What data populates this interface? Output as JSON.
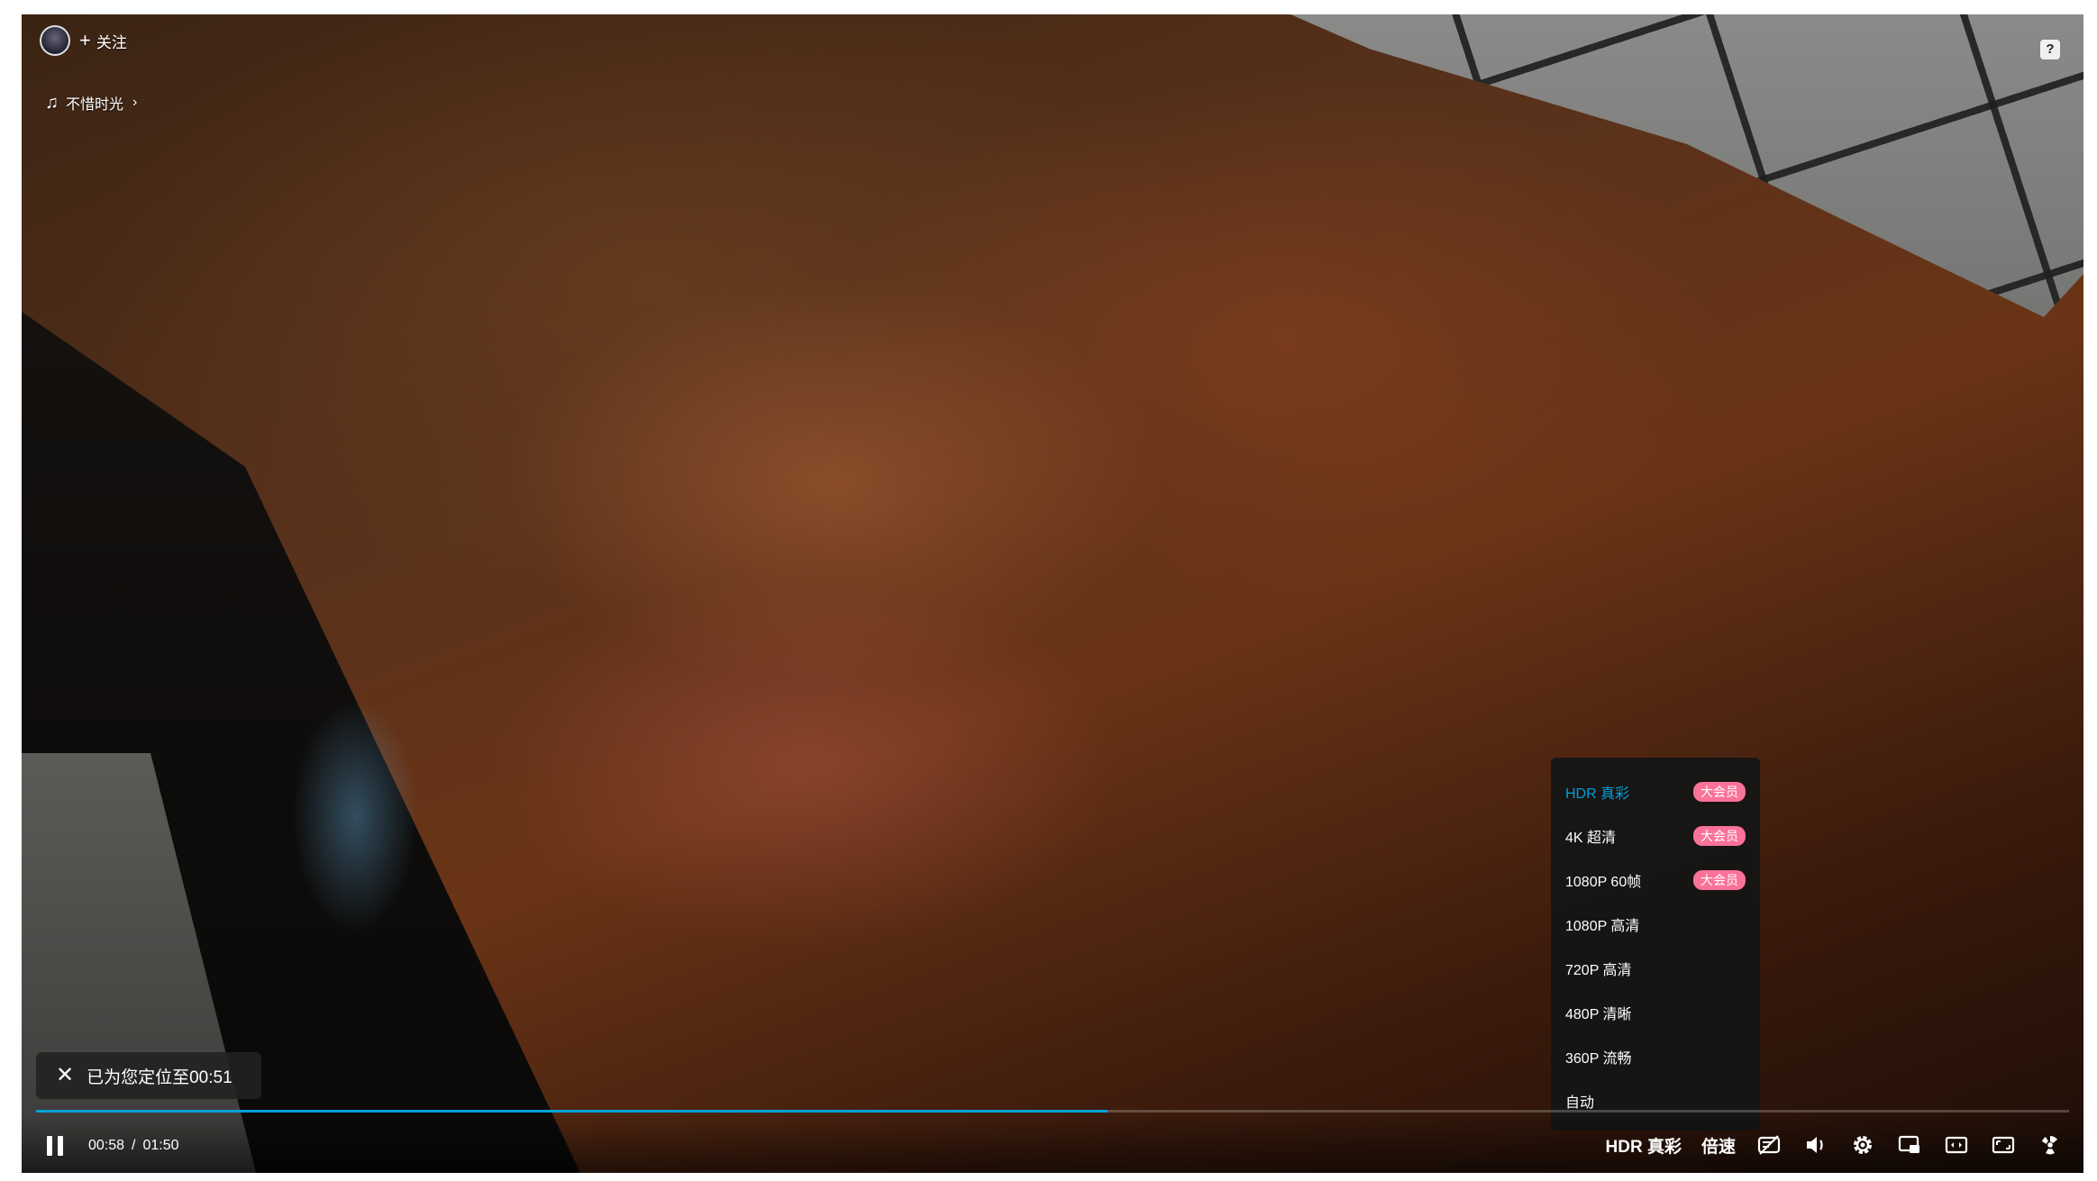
{
  "uploader": {
    "follow_label": "关注"
  },
  "music": {
    "title": "不惜时光"
  },
  "help": {
    "icon": "?"
  },
  "quality_menu": {
    "items": [
      {
        "label": "HDR 真彩",
        "badge": "大会员",
        "active": true
      },
      {
        "label": "4K 超清",
        "badge": "大会员",
        "active": false
      },
      {
        "label": "1080P 60帧",
        "badge": "大会员",
        "active": false
      },
      {
        "label": "1080P 高清",
        "badge": "",
        "active": false
      },
      {
        "label": "720P 高清",
        "badge": "",
        "active": false
      },
      {
        "label": "480P 清晰",
        "badge": "",
        "active": false
      },
      {
        "label": "360P 流畅",
        "badge": "",
        "active": false
      },
      {
        "label": "自动",
        "badge": "",
        "active": false
      }
    ]
  },
  "toast": {
    "message": "已为您定位至00:51"
  },
  "playback": {
    "current_time": "00:58",
    "separator": "/",
    "duration": "01:50",
    "progress_fraction": 0.527
  },
  "controls": {
    "quality_label": "HDR 真彩",
    "speed_label": "倍速",
    "icons": [
      "danmaku-off-icon",
      "volume-icon",
      "settings-icon",
      "pip-icon",
      "widescreen-icon",
      "web-fullscreen-icon",
      "fullscreen-icon"
    ]
  },
  "colors": {
    "accent": "#00a1d6",
    "vip_badge": "#fb7299"
  }
}
